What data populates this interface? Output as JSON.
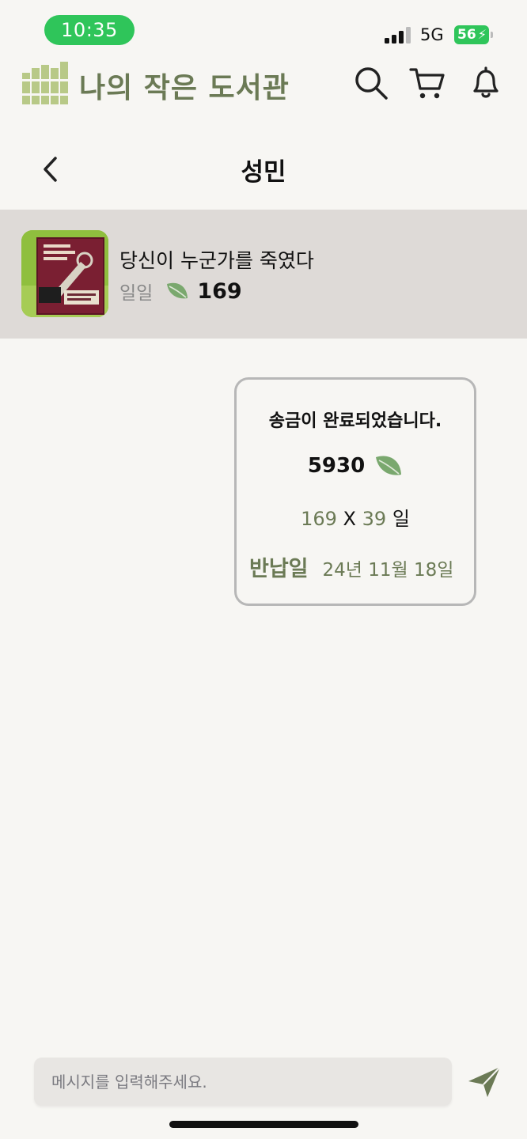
{
  "status_bar": {
    "time": "10:35",
    "network": "5G",
    "battery": "56"
  },
  "app": {
    "title": "나의 작은 도서관"
  },
  "chat": {
    "title": "성민"
  },
  "product": {
    "name": "당신이 누군가를 죽였다",
    "price_unit": "일일",
    "price": "169"
  },
  "message": {
    "title": "송금이 완료되었습니다.",
    "amount": "5930",
    "daily_price": "169",
    "times": "X",
    "days": "39",
    "days_unit": "일",
    "due_label": "반납일",
    "due_date": "24년 11월 18일"
  },
  "input": {
    "placeholder": "메시지를 입력해주세요."
  },
  "colors": {
    "accent": "#6b7a55",
    "leaf": "#7aa86e",
    "logo": "#b8c987",
    "status_green": "#2fc55a"
  },
  "icons": {
    "logo": "bookshelf-icon",
    "search": "search-icon",
    "cart": "cart-icon",
    "notifications": "bell-icon",
    "back": "chevron-left-icon",
    "currency": "leaf-icon",
    "send": "send-icon"
  }
}
